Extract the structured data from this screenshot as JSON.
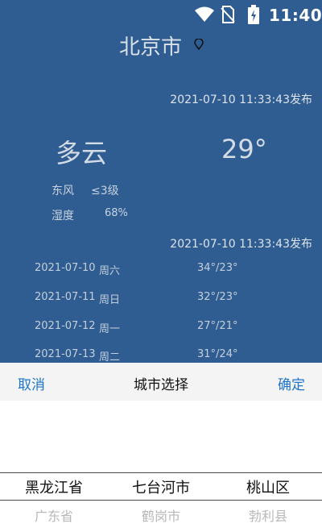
{
  "status_bar": {
    "time": "11:40",
    "icons": [
      "wifi-icon",
      "no-sim-icon",
      "battery-charging-icon"
    ]
  },
  "weather": {
    "city": "北京市",
    "publish_time_current": "2021-07-10 11:33:43发布",
    "condition": "多云",
    "temperature": "29°",
    "wind_label": "东风",
    "wind_value": "≤3级",
    "humidity_label": "湿度",
    "humidity_value": "68%",
    "publish_time_forecast": "2021-07-10 11:33:43发布",
    "forecast": [
      {
        "date": "2021-07-10",
        "weekday": "周六",
        "range": "34°/23°"
      },
      {
        "date": "2021-07-11",
        "weekday": "周日",
        "range": "32°/23°"
      },
      {
        "date": "2021-07-12",
        "weekday": "周一",
        "range": "27°/21°"
      },
      {
        "date": "2021-07-13",
        "weekday": "周二",
        "range": "31°/24°"
      }
    ]
  },
  "picker": {
    "cancel_label": "取消",
    "title": "城市选择",
    "confirm_label": "确定",
    "columns": [
      {
        "selected": "黑龙江省",
        "next": "广东省"
      },
      {
        "selected": "七台河市",
        "next": "鹤岗市"
      },
      {
        "selected": "桃山区",
        "next": "勃利县"
      }
    ]
  },
  "colors": {
    "background": "#2f5d91",
    "accent": "#1e74c9"
  }
}
